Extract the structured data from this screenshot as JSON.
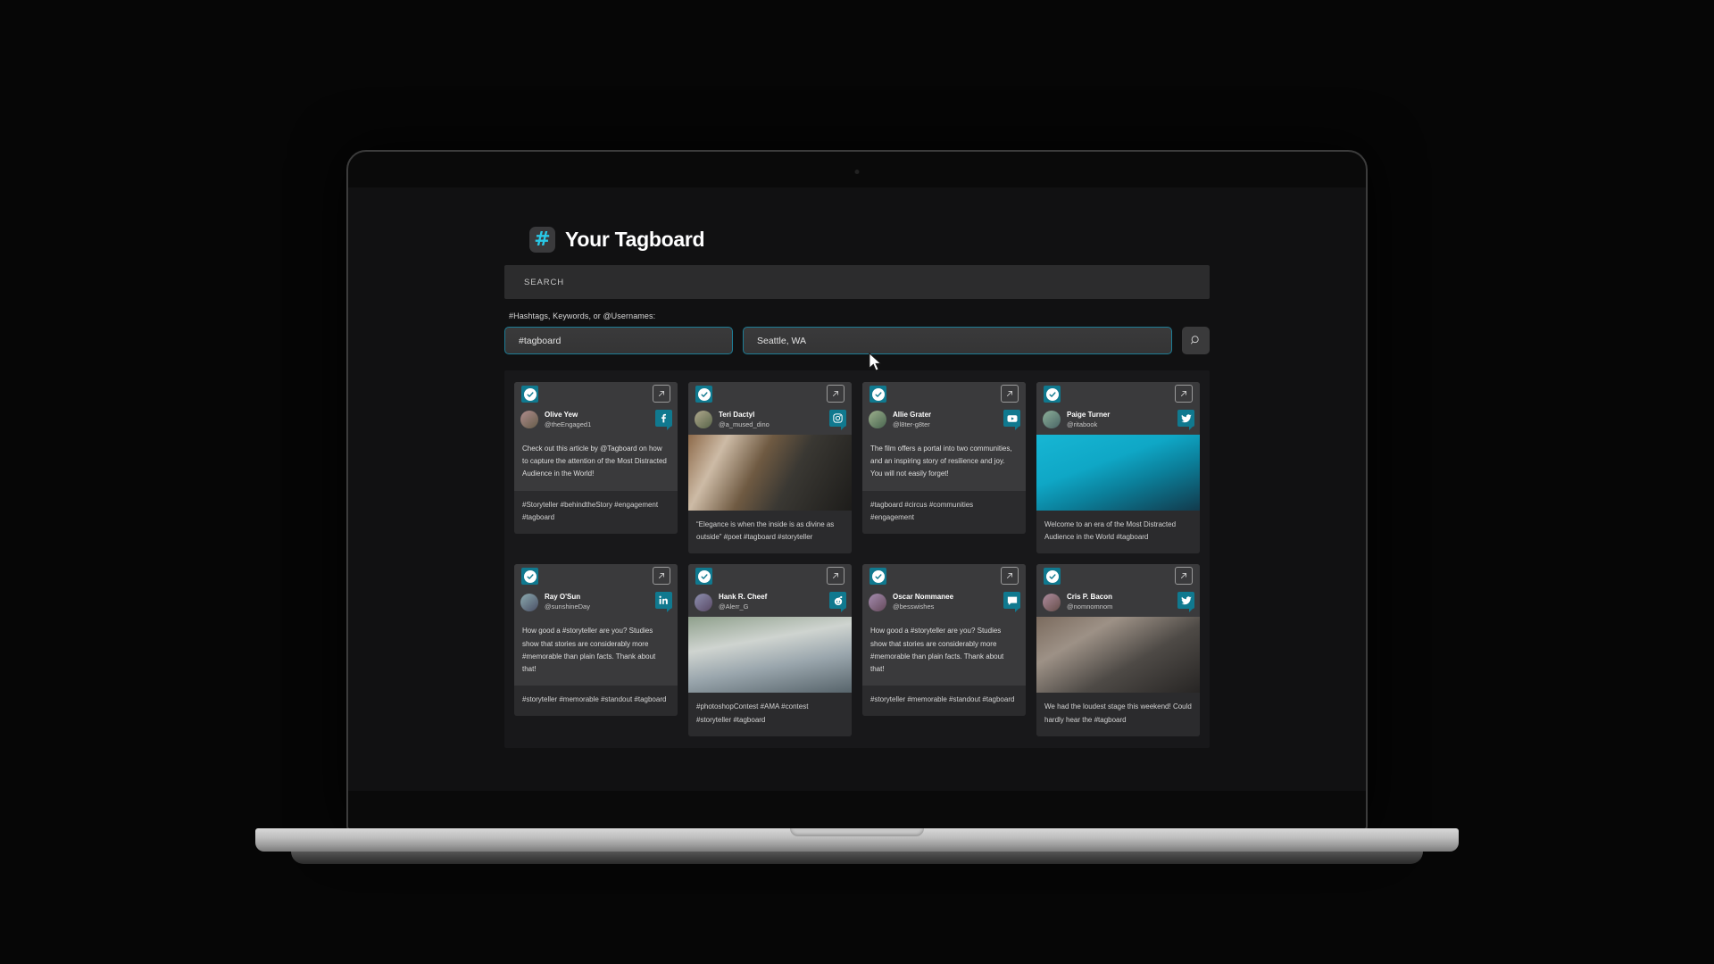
{
  "brand": {
    "title": "Your Tagboard",
    "logo_glyph": "#"
  },
  "search": {
    "bar_label": "SEARCH",
    "field_label": "#Hashtags, Keywords, or @Usernames:",
    "hashtag_value": "#tagboard",
    "location_value": "Seattle, WA",
    "button_icon": "search-icon"
  },
  "theme": {
    "accent": "#10798f",
    "logo_cyan": "#29c8e6",
    "panel": "#18181a",
    "card": "#2b2b2d"
  },
  "cards": [
    {
      "name": "Olive Yew",
      "handle": "@theEngaged1",
      "network": "facebook",
      "text": "Check out this article by @Tagboard on how to capture the attention of the Most Distracted Audience in the World!",
      "tags": "#Storyteller #behindtheStory #engagement #tagboard",
      "has_media": false
    },
    {
      "name": "Teri Dactyl",
      "handle": "@a_mused_dino",
      "network": "instagram",
      "text": "",
      "tags": "“Elegance is when the inside is as divine as outside” #poet #tagboard #storyteller",
      "has_media": true
    },
    {
      "name": "Allie Grater",
      "handle": "@l8ter-g8ter",
      "network": "youtube",
      "text": "The film offers a portal into two communities, and an inspiring story of resilience and joy. You will not easily forget!",
      "tags": "#tagboard #circus #communities #engagement",
      "has_media": false
    },
    {
      "name": "Paige Turner",
      "handle": "@ritabook",
      "network": "twitter",
      "text": "",
      "tags": "Welcome to an era  of the Most Distracted Audience in the World #tagboard",
      "has_media": true
    },
    {
      "name": "Ray O'Sun",
      "handle": "@sunshineDay",
      "network": "linkedin",
      "text": "How good a #storyteller are you? Studies show that stories are considerably more #memorable than plain facts. Thank about that!",
      "tags": "#storyteller #memorable #standout #tagboard",
      "has_media": false
    },
    {
      "name": "Hank R. Cheef",
      "handle": "@Alerr_G",
      "network": "reddit",
      "text": "",
      "tags": "#photoshopContest #AMA #contest #storyteller #tagboard",
      "has_media": true
    },
    {
      "name": "Oscar Nommanee",
      "handle": "@besswishes",
      "network": "message",
      "text": "How good a #storyteller are you? Studies show that stories are considerably more #memorable than plain facts. Thank about that!",
      "tags": "#storyteller #memorable #standout #tagboard",
      "has_media": false
    },
    {
      "name": "Cris P. Bacon",
      "handle": "@nomnomnom",
      "network": "twitter",
      "text": "",
      "tags": "We had the loudest stage this weekend! Could hardly hear the #tagboard",
      "has_media": true
    }
  ]
}
